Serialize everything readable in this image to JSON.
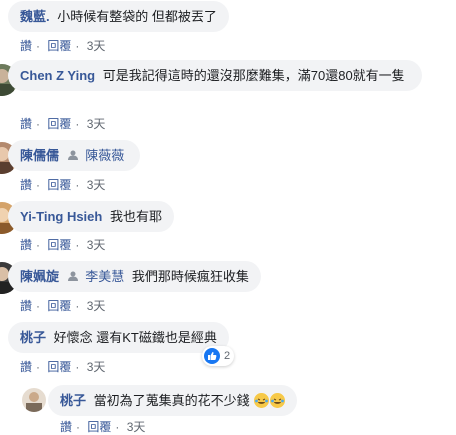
{
  "comments": [
    {
      "name": "魏藍.",
      "text": "小時候有整袋的 但都被丟了",
      "actions": [
        "讚",
        "回覆"
      ],
      "time": "3天"
    },
    {
      "name": "Chen Z Ying",
      "text": "可是我記得這時的還沒那麼難集，滿70還80就有一隻",
      "actions": [
        "讚",
        "回覆"
      ],
      "time": "3天"
    },
    {
      "name": "陳儒儒",
      "tag": "陳薇薇",
      "actions": [
        "讚",
        "回覆"
      ],
      "time": "3天"
    },
    {
      "name": "Yi-Ting Hsieh",
      "text": "我也有耶",
      "actions": [
        "讚",
        "回覆"
      ],
      "time": "3天"
    },
    {
      "name": "陳姵旋",
      "tag": "李美慧",
      "text": "我們那時候瘋狂收集",
      "actions": [
        "讚",
        "回覆"
      ],
      "time": "3天"
    },
    {
      "name": "桃子",
      "text": "好懷念 還有KT磁鐵也是經典",
      "actions": [
        "讚",
        "回覆"
      ],
      "time": "3天",
      "reaction_count": "2",
      "reaction_icon": "like-icon"
    },
    {
      "name": "桃子",
      "text": "當初為了蒐集真的花不少錢",
      "actions": [
        "讚",
        "回覆"
      ],
      "time": "3天",
      "emoji_icon": "laughing-crying-emoji-icon"
    }
  ],
  "colors": {
    "link": "#385898",
    "bubble": "#f2f3f5",
    "meta": "#606770",
    "like_blue": "#1877f2"
  }
}
